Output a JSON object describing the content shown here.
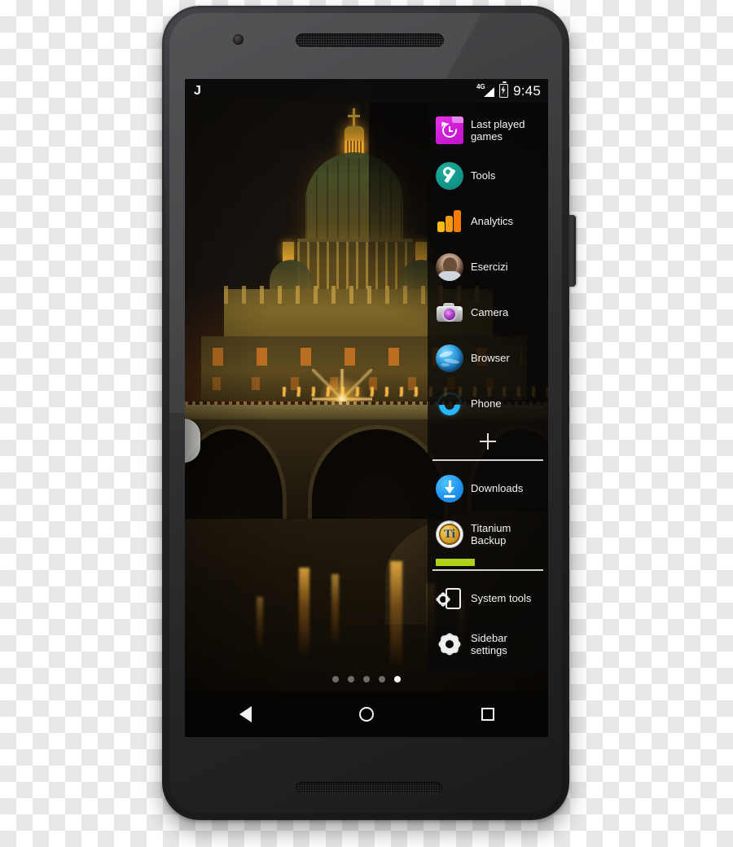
{
  "device": {
    "name": "android-smartphone",
    "front_camera": "front-camera-icon",
    "earpiece": "earpiece-speaker",
    "bottom_speaker": "bottom-speaker",
    "power_button": "power-button"
  },
  "status_bar": {
    "left_letter": "J",
    "signal_label": "4G",
    "signal_icon": "signal-bars-icon",
    "battery_icon": "battery-charging-icon",
    "clock": "9:45"
  },
  "sidebar": {
    "handle": "sidebar-handle",
    "items": [
      {
        "label": "Last played games",
        "icon": "last-played-games-icon"
      },
      {
        "label": "Tools",
        "icon": "tools-wrench-icon"
      },
      {
        "label": "Analytics",
        "icon": "analytics-bars-icon"
      },
      {
        "label": "Esercizi",
        "icon": "avatar-photo-icon"
      },
      {
        "label": "Camera",
        "icon": "camera-icon"
      },
      {
        "label": "Browser",
        "icon": "browser-globe-icon"
      },
      {
        "label": "Phone",
        "icon": "phone-handset-icon"
      }
    ],
    "add_button": {
      "label": "+",
      "icon": "plus-icon"
    },
    "running_items": [
      {
        "label": "Downloads",
        "icon": "downloads-icon"
      },
      {
        "label": "Titanium Backup",
        "icon": "titanium-backup-icon"
      }
    ],
    "progress": {
      "value": 36,
      "color": "#b0d11a"
    },
    "bottom_items": [
      {
        "label": "System tools",
        "icon": "system-tools-icon"
      },
      {
        "label": "Sidebar settings",
        "icon": "gear-icon"
      }
    ]
  },
  "home_screen": {
    "page_dots": {
      "count": 5,
      "active_index": 4
    },
    "wallpaper": "rome-st-peters-basilica-night"
  },
  "nav_bar": {
    "back": "back-triangle-icon",
    "home": "home-circle-icon",
    "recents": "recents-square-icon"
  },
  "colors": {
    "accent_magenta": "#d01fd8",
    "accent_teal": "#12998a",
    "accent_blue": "#2196f3",
    "progress_green": "#b0d11a",
    "panel_bg": "rgba(10,9,8,0.80)"
  }
}
